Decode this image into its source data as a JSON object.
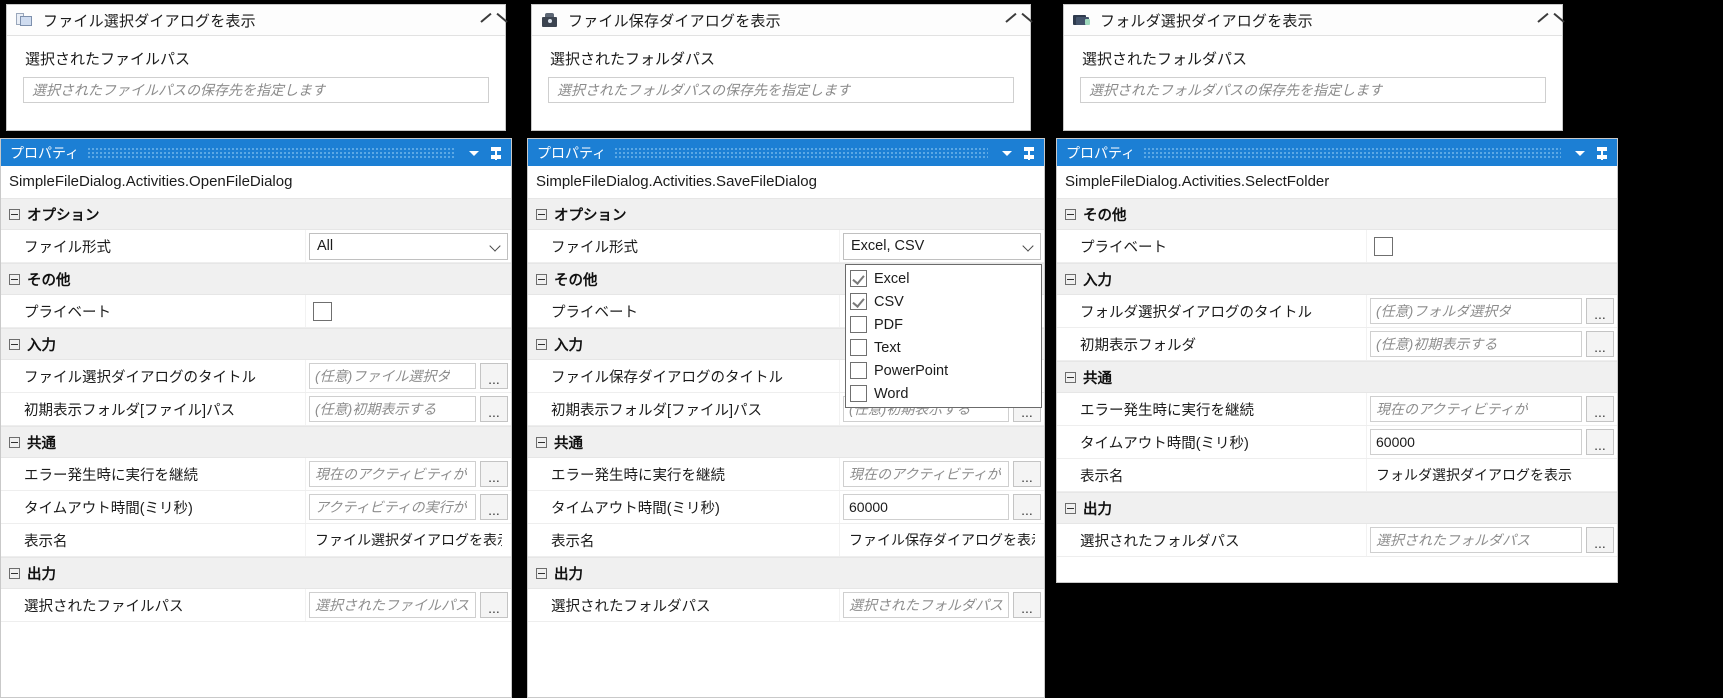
{
  "panels": [
    {
      "id": "open",
      "activity": {
        "icon": "open-file-dialog-icon",
        "title": "ファイル選択ダイアログを表示",
        "collapse_icon": "chevron-up-icon",
        "field_label": "選択されたファイルパス",
        "field_placeholder": "選択されたファイルパスの保存先を指定します"
      },
      "properties": {
        "header_title": "プロパティ",
        "caret_icon": "chevron-down-icon",
        "pin_icon": "pin-icon",
        "type_name": "SimpleFileDialog.Activities.OpenFileDialog",
        "groups": [
          {
            "name": "オプション",
            "rows": [
              {
                "name": "ファイル形式",
                "kind": "combo",
                "value": "All"
              }
            ]
          },
          {
            "name": "その他",
            "rows": [
              {
                "name": "プライベート",
                "kind": "checkbox",
                "checked": false
              }
            ]
          },
          {
            "name": "入力",
            "rows": [
              {
                "name": "ファイル選択ダイアログのタイトル",
                "kind": "textbox",
                "placeholder": "(任意)ファイル選択ダ",
                "ellipsis": "..."
              },
              {
                "name": "初期表示フォルダ[ファイル]パス",
                "kind": "textbox",
                "placeholder": "(任意)初期表示する",
                "ellipsis": "..."
              }
            ]
          },
          {
            "name": "共通",
            "rows": [
              {
                "name": "エラー発生時に実行を継続",
                "kind": "textbox",
                "placeholder": "現在のアクティビティが",
                "ellipsis": "..."
              },
              {
                "name": "タイムアウト時間(ミリ秒)",
                "kind": "textbox",
                "placeholder": "アクティビティの実行が",
                "ellipsis": "..."
              },
              {
                "name": "表示名",
                "kind": "plain",
                "value": "ファイル選択ダイアログを表示"
              }
            ]
          },
          {
            "name": "出力",
            "rows": [
              {
                "name": "選択されたファイルパス",
                "kind": "textbox",
                "placeholder": "選択されたファイルパス",
                "ellipsis": "..."
              }
            ]
          }
        ]
      }
    },
    {
      "id": "save",
      "activity": {
        "icon": "save-file-dialog-icon",
        "title": "ファイル保存ダイアログを表示",
        "collapse_icon": "chevron-up-icon",
        "field_label": "選択されたフォルダパス",
        "field_placeholder": "選択されたフォルダパスの保存先を指定します"
      },
      "properties": {
        "header_title": "プロパティ",
        "caret_icon": "chevron-down-icon",
        "pin_icon": "pin-icon",
        "type_name": "SimpleFileDialog.Activities.SaveFileDialog",
        "groups": [
          {
            "name": "オプション",
            "rows": [
              {
                "name": "ファイル形式",
                "kind": "combo",
                "value": "Excel, CSV"
              }
            ]
          },
          {
            "name": "その他",
            "rows": [
              {
                "name": "プライベート",
                "kind": "blank"
              }
            ]
          },
          {
            "name": "入力",
            "rows": [
              {
                "name": "ファイル保存ダイアログのタイトル",
                "kind": "blank"
              },
              {
                "name": "初期表示フォルダ[ファイル]パス",
                "kind": "textbox",
                "placeholder": "(任意)初期表示する",
                "ellipsis": "..."
              }
            ]
          },
          {
            "name": "共通",
            "rows": [
              {
                "name": "エラー発生時に実行を継続",
                "kind": "textbox",
                "placeholder": "現在のアクティビティが",
                "ellipsis": "..."
              },
              {
                "name": "タイムアウト時間(ミリ秒)",
                "kind": "textbox-value",
                "value": "60000",
                "ellipsis": "..."
              },
              {
                "name": "表示名",
                "kind": "plain",
                "value": "ファイル保存ダイアログを表示"
              }
            ]
          },
          {
            "name": "出力",
            "rows": [
              {
                "name": "選択されたフォルダパス",
                "kind": "textbox",
                "placeholder": "選択されたフォルダパス",
                "ellipsis": "..."
              }
            ]
          }
        ],
        "dropdown": {
          "open": true,
          "options": [
            {
              "label": "Excel",
              "checked": true
            },
            {
              "label": "CSV",
              "checked": true
            },
            {
              "label": "PDF",
              "checked": false
            },
            {
              "label": "Text",
              "checked": false
            },
            {
              "label": "PowerPoint",
              "checked": false
            },
            {
              "label": "Word",
              "checked": false
            }
          ]
        }
      }
    },
    {
      "id": "folder",
      "activity": {
        "icon": "select-folder-dialog-icon",
        "title": "フォルダ選択ダイアログを表示",
        "collapse_icon": "chevron-up-icon",
        "field_label": "選択されたフォルダパス",
        "field_placeholder": "選択されたフォルダパスの保存先を指定します"
      },
      "properties": {
        "header_title": "プロパティ",
        "caret_icon": "chevron-down-icon",
        "pin_icon": "pin-icon",
        "type_name": "SimpleFileDialog.Activities.SelectFolder",
        "groups": [
          {
            "name": "その他",
            "rows": [
              {
                "name": "プライベート",
                "kind": "checkbox",
                "checked": false
              }
            ]
          },
          {
            "name": "入力",
            "rows": [
              {
                "name": "フォルダ選択ダイアログのタイトル",
                "kind": "textbox",
                "placeholder": "(任意)フォルダ選択ダ",
                "ellipsis": "..."
              },
              {
                "name": "初期表示フォルダ",
                "kind": "textbox",
                "placeholder": "(任意)初期表示する",
                "ellipsis": "..."
              }
            ]
          },
          {
            "name": "共通",
            "rows": [
              {
                "name": "エラー発生時に実行を継続",
                "kind": "textbox",
                "placeholder": "現在のアクティビティが",
                "ellipsis": "..."
              },
              {
                "name": "タイムアウト時間(ミリ秒)",
                "kind": "textbox-value",
                "value": "60000",
                "ellipsis": "..."
              },
              {
                "name": "表示名",
                "kind": "plain",
                "value": "フォルダ選択ダイアログを表示"
              }
            ]
          },
          {
            "name": "出力",
            "rows": [
              {
                "name": "選択されたフォルダパス",
                "kind": "textbox",
                "placeholder": "選択されたフォルダパス",
                "ellipsis": "..."
              }
            ]
          }
        ]
      }
    }
  ],
  "layout": {
    "accent": "#1c7fd4",
    "panel_geometry": [
      {
        "act": [
          6,
          4,
          500,
          127
        ],
        "props": [
          0,
          138,
          512,
          560
        ],
        "namew": 305
      },
      {
        "act": [
          531,
          4,
          500,
          127
        ],
        "props": [
          527,
          138,
          518,
          560
        ],
        "namew": 312
      },
      {
        "act": [
          1063,
          4,
          500,
          127
        ],
        "props": [
          1056,
          138,
          562,
          445
        ],
        "namew": 310
      }
    ]
  }
}
